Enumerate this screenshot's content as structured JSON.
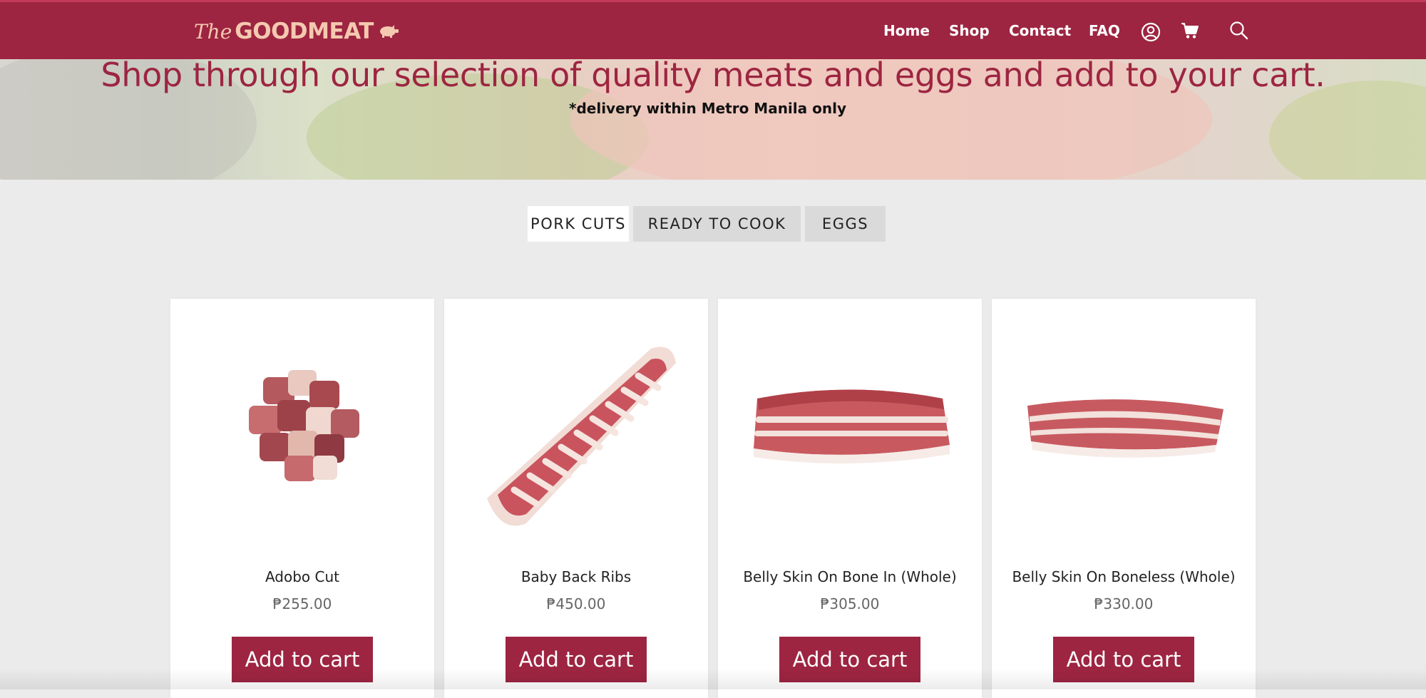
{
  "header": {
    "logo": {
      "the": "The",
      "main": "GOODMEAT"
    },
    "nav": [
      {
        "label": "Home"
      },
      {
        "label": "Shop"
      },
      {
        "label": "Contact"
      },
      {
        "label": "FAQ"
      }
    ],
    "icons": [
      "account-icon",
      "cart-icon",
      "search-icon"
    ]
  },
  "hero": {
    "title": "Shop through our selection of quality meats and eggs and add to your cart.",
    "subtitle": "*delivery within Metro Manila only"
  },
  "tabs": [
    {
      "label": "PORK CUTS",
      "active": true
    },
    {
      "label": "READY TO COOK",
      "active": false
    },
    {
      "label": "EGGS",
      "active": false
    }
  ],
  "products": [
    {
      "name": "Adobo Cut",
      "price": "₱255.00",
      "button": "Add to cart"
    },
    {
      "name": "Baby Back Ribs",
      "price": "₱450.00",
      "button": "Add to cart"
    },
    {
      "name": "Belly Skin On Bone In (Whole)",
      "price": "₱305.00",
      "button": "Add to cart"
    },
    {
      "name": "Belly Skin On Boneless (Whole)",
      "price": "₱330.00",
      "button": "Add to cart"
    }
  ],
  "colors": {
    "brand": "#9d2541",
    "logo": "#f4c9b0",
    "background": "#ebebeb"
  }
}
